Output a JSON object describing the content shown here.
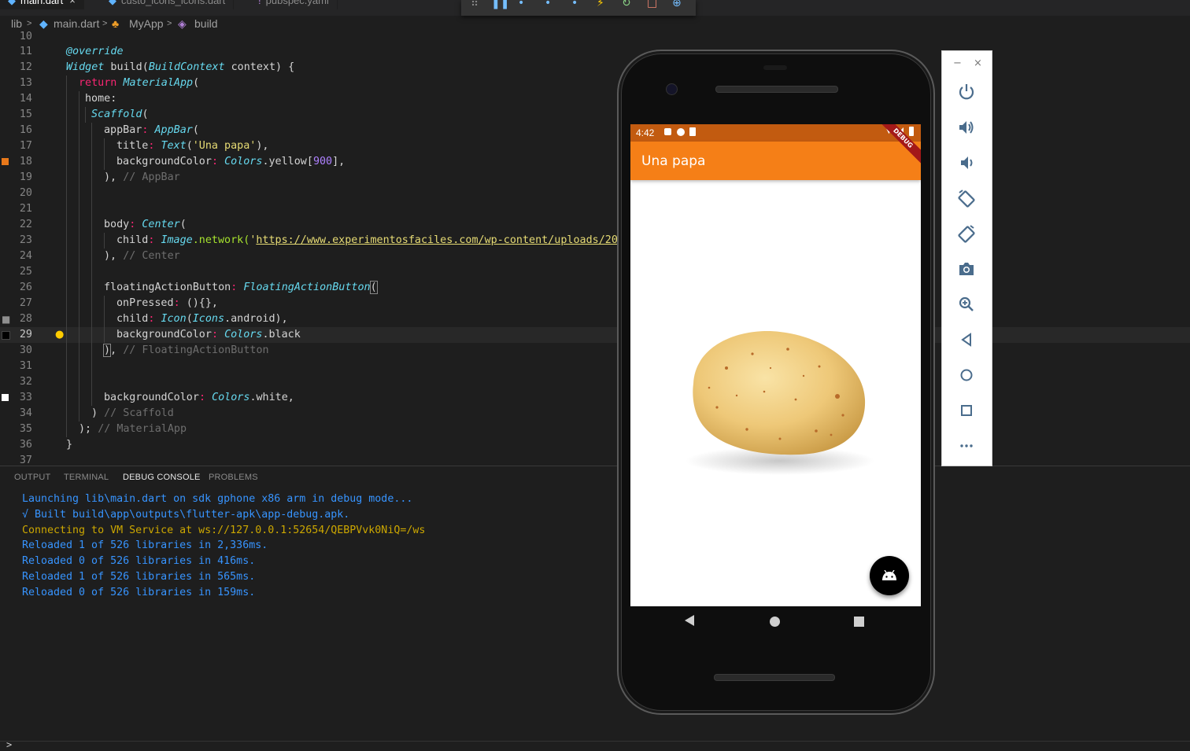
{
  "tabs": [
    {
      "label": "main.dart",
      "close": "×",
      "active": true
    },
    {
      "label": "custo_icons_icons.dart",
      "active": false
    },
    {
      "label": "pubspec.yaml",
      "active": false
    }
  ],
  "breadcrumb": {
    "items": [
      "lib",
      "main.dart",
      "MyApp",
      "build"
    ],
    "sep": ">"
  },
  "editor": {
    "line_numbers": [
      "10",
      "11",
      "12",
      "13",
      "14",
      "15",
      "16",
      "17",
      "18",
      "19",
      "20",
      "21",
      "22",
      "23",
      "24",
      "25",
      "26",
      "27",
      "28",
      "29",
      "30",
      "31",
      "32",
      "33",
      "34",
      "35",
      "36",
      "37"
    ],
    "lines": {
      "l11": "@override",
      "l12a": "Widget",
      "l12b": " build(",
      "l12c": "BuildContext",
      "l12d": " context) {",
      "l13a": "return",
      "l13b": " ",
      "l13c": "MaterialApp",
      "l13d": "(",
      "l14": "home:",
      "l15a": "Scaffold",
      "l15b": "(",
      "l16a": "appBar",
      "l16b": ": ",
      "l16c": "AppBar",
      "l16d": "(",
      "l17a": "title",
      "l17b": ": ",
      "l17c": "Text",
      "l17d": "(",
      "l17e": "'Una papa'",
      "l17f": "),",
      "l18a": "backgroundColor",
      "l18b": ": ",
      "l18c": "Colors",
      "l18d": ".yellow[",
      "l18e": "900",
      "l18f": "],",
      "l19a": "), ",
      "l19b": "// AppBar",
      "l22a": "body",
      "l22b": ": ",
      "l22c": "Center",
      "l22d": "(",
      "l23a": "child",
      "l23b": ": ",
      "l23c": "Image",
      "l23d": ".network(",
      "l23e": "'",
      "l23f": "https://www.experimentosfaciles.com/wp-content/uploads/20",
      "l24a": "), ",
      "l24b": "// Center",
      "l26a": "floatingActionButton",
      "l26b": ": ",
      "l26c": "FloatingActionButton",
      "l26d": "(",
      "l27a": "onPressed",
      "l27b": ": ",
      "l27c": "(){},",
      "l28a": "child",
      "l28b": ": ",
      "l28c": "Icon",
      "l28d": "(",
      "l28e": "Icons",
      "l28f": ".android),",
      "l29a": "backgroundColor",
      "l29b": ": ",
      "l29c": "Colors",
      "l29d": ".black",
      "l30a": "), ",
      "l30b": "// FloatingActionButton",
      "l33a": "backgroundColor",
      "l33b": ": ",
      "l33c": "Colors",
      "l33d": ".white,",
      "l34a": ") ",
      "l34b": "// Scaffold",
      "l35a": "); ",
      "l35b": "// MaterialApp",
      "l36": "}"
    },
    "marker_colors": {
      "orange": "#e8781a",
      "black": "#000000",
      "white": "#ffffff"
    }
  },
  "panel": {
    "tabs": [
      "OUTPUT",
      "TERMINAL",
      "DEBUG CONSOLE",
      "PROBLEMS"
    ],
    "active_tab": "DEBUG CONSOLE",
    "console": [
      {
        "text": "Launching lib\\main.dart on sdk gphone x86 arm in debug mode...",
        "color": "#3794ff"
      },
      {
        "text": "√ Built build\\app\\outputs\\flutter-apk\\app-debug.apk.",
        "color": "#3794ff"
      },
      {
        "text": "Connecting to VM Service at ws://127.0.0.1:52654/QEBPVvk0NiQ=/ws",
        "color": "#cca700"
      },
      {
        "text": "Reloaded 1 of 526 libraries in 2,336ms.",
        "color": "#3794ff"
      },
      {
        "text": "Reloaded 0 of 526 libraries in 416ms.",
        "color": "#3794ff"
      },
      {
        "text": "Reloaded 1 of 526 libraries in 565ms.",
        "color": "#3794ff"
      },
      {
        "text": "Reloaded 0 of 526 libraries in 159ms.",
        "color": "#3794ff"
      }
    ],
    "prompt": ">"
  },
  "device": {
    "time": "4:42",
    "app_title": "Una papa",
    "debug_banner": "DEBUG",
    "appbar_color": "#f57f17",
    "statusbar_color": "#c25b10",
    "fab_icon": "android-icon",
    "nav": [
      "back-icon",
      "home-icon",
      "recents-icon"
    ]
  },
  "emulator_controls": {
    "window": [
      "−",
      "×"
    ],
    "buttons": [
      "power-icon",
      "volume-up-icon",
      "volume-down-icon",
      "rotate-left-icon",
      "rotate-right-icon",
      "camera-icon",
      "zoom-icon",
      "back-icon",
      "home-icon",
      "overview-icon",
      "more-icon"
    ]
  }
}
